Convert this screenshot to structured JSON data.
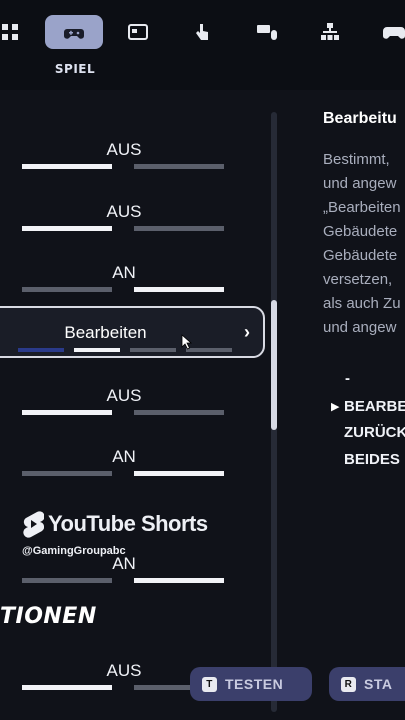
{
  "tabs": {
    "active_label": "SPIEL",
    "items": [
      "grid-icon",
      "gamepad-icon",
      "layout-icon",
      "touch-icon",
      "keyboard-mouse-icon",
      "network-icon",
      "controller-icon"
    ]
  },
  "settings": [
    {
      "value": "AUS"
    },
    {
      "value": "AUS"
    },
    {
      "value": "AN"
    },
    {
      "value": "Bearbeiten"
    },
    {
      "value": "AUS"
    },
    {
      "value": "AN"
    },
    {
      "value": "AN"
    },
    {
      "value": "AUS"
    }
  ],
  "section": {
    "title": "TIONEN"
  },
  "detail": {
    "title": "Bearbeitu",
    "lines": [
      "Bestimmt,",
      "und angew",
      "„Bearbeiten",
      "Gebäudete",
      "Gebäudete",
      "versetzen,",
      "als auch Zu",
      "und angew"
    ],
    "options": [
      "-",
      "BEARBE",
      "ZURÜCK",
      "BEIDES"
    ]
  },
  "watermark": {
    "brand": "YouTube Shorts",
    "handle": "@GamingGroupabc"
  },
  "buttons": {
    "test": {
      "key": "T",
      "label": "TESTEN"
    },
    "start": {
      "key": "R",
      "label": "STA"
    }
  },
  "colors": {
    "accent_tab": "#9aa3c9",
    "button_bg": "#3b3f6b",
    "background": "#101219"
  }
}
